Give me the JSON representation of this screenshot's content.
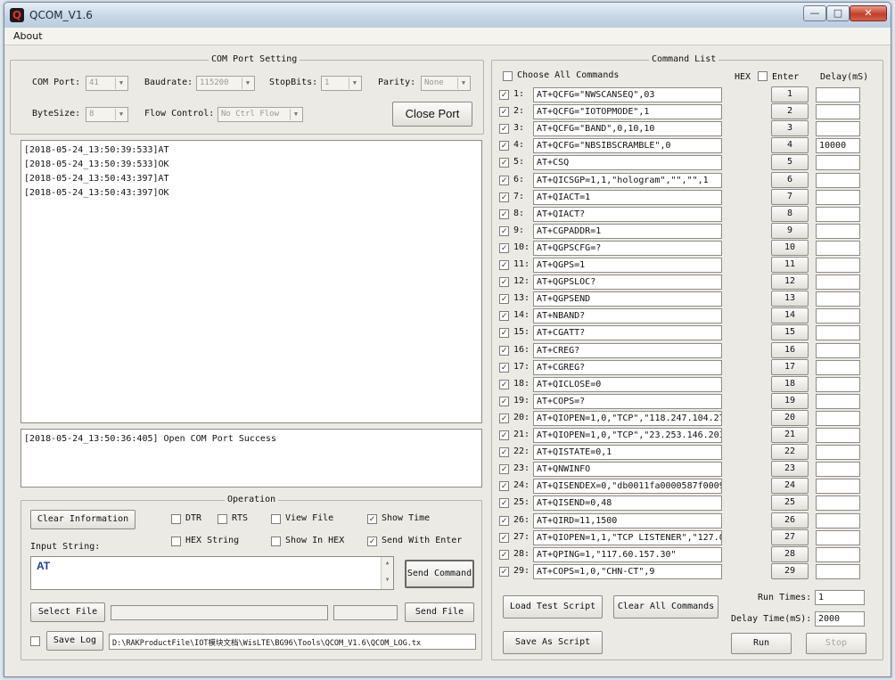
{
  "window": {
    "title": "QCOM_V1.6",
    "minimize": "—",
    "maximize": "□",
    "close": "✕"
  },
  "menu": {
    "about": "About"
  },
  "com_port_setting": {
    "title": "COM Port Setting",
    "com_port_label": "COM Port:",
    "com_port_value": "41",
    "baudrate_label": "Baudrate:",
    "baudrate_value": "115200",
    "stopbits_label": "StopBits:",
    "stopbits_value": "1",
    "parity_label": "Parity:",
    "parity_value": "None",
    "bytesize_label": "ByteSize:",
    "bytesize_value": "8",
    "flow_control_label": "Flow Control:",
    "flow_control_value": "No Ctrl Flow",
    "close_port_button": "Close Port"
  },
  "receive_log": [
    "[2018-05-24_13:50:39:533]AT",
    "[2018-05-24_13:50:39:533]OK",
    "[2018-05-24_13:50:43:397]AT",
    "[2018-05-24_13:50:43:397]OK"
  ],
  "status_log": [
    "[2018-05-24_13:50:36:405] Open COM Port Success"
  ],
  "operation": {
    "title": "Operation",
    "clear_information": "Clear Information",
    "dtr": "DTR",
    "dtr_checked": false,
    "rts": "RTS",
    "rts_checked": false,
    "view_file": "View File",
    "view_file_checked": false,
    "show_time": "Show Time",
    "show_time_checked": true,
    "hex_string": "HEX String",
    "hex_string_checked": false,
    "show_in_hex": "Show In HEX",
    "show_in_hex_checked": false,
    "send_with_enter": "Send With Enter",
    "send_with_enter_checked": true,
    "input_string_label": "Input String:",
    "input_string_value": "AT",
    "send_command": "Send Command",
    "select_file": "Select File",
    "send_file": "Send File",
    "save_log": "Save Log",
    "save_log_checked": false,
    "log_path": "D:\\RAKProductFile\\IOT模块文档\\WisLTE\\BG96\\Tools\\QCOM_V1.6\\QCOM_LOG.tx"
  },
  "command_list": {
    "title": "Command List",
    "choose_all_label": "Choose All Commands",
    "hex_header": "HEX",
    "enter_header": "Enter",
    "delay_header": "Delay(mS)",
    "commands": [
      {
        "num": "1:",
        "cmd": "AT+QCFG=\"NWSCANSEQ\",03",
        "checked": true,
        "hex": false,
        "enter": true,
        "button": "1",
        "delay": ""
      },
      {
        "num": "2:",
        "cmd": "AT+QCFG=\"IOTOPMODE\",1",
        "checked": true,
        "hex": false,
        "enter": true,
        "button": "2",
        "delay": ""
      },
      {
        "num": "3:",
        "cmd": "AT+QCFG=\"BAND\",0,10,10",
        "checked": true,
        "hex": false,
        "enter": true,
        "button": "3",
        "delay": ""
      },
      {
        "num": "4:",
        "cmd": "AT+QCFG=\"NBSIBSCRAMBLE\",0",
        "checked": true,
        "hex": false,
        "enter": true,
        "button": "4",
        "delay": "10000"
      },
      {
        "num": "5:",
        "cmd": "AT+CSQ",
        "checked": true,
        "hex": false,
        "enter": true,
        "button": "5",
        "delay": ""
      },
      {
        "num": "6:",
        "cmd": "AT+QICSGP=1,1,\"hologram\",\"\",\"\",1",
        "checked": true,
        "hex": false,
        "enter": true,
        "button": "6",
        "delay": ""
      },
      {
        "num": "7:",
        "cmd": "AT+QIACT=1",
        "checked": true,
        "hex": false,
        "enter": true,
        "button": "7",
        "delay": ""
      },
      {
        "num": "8:",
        "cmd": "AT+QIACT?",
        "checked": true,
        "hex": false,
        "enter": true,
        "button": "8",
        "delay": ""
      },
      {
        "num": "9:",
        "cmd": "AT+CGPADDR=1",
        "checked": false,
        "hex": false,
        "enter": true,
        "button": "9",
        "delay": ""
      },
      {
        "num": "10:",
        "cmd": "AT+QGPSCFG=?",
        "checked": false,
        "hex": false,
        "enter": true,
        "button": "10",
        "delay": ""
      },
      {
        "num": "11:",
        "cmd": "AT+QGPS=1",
        "checked": false,
        "hex": false,
        "enter": true,
        "button": "11",
        "delay": ""
      },
      {
        "num": "12:",
        "cmd": "AT+QGPSLOC?",
        "checked": false,
        "hex": false,
        "enter": true,
        "button": "12",
        "delay": ""
      },
      {
        "num": "13:",
        "cmd": "AT+QGPSEND",
        "checked": false,
        "hex": false,
        "enter": true,
        "button": "13",
        "delay": ""
      },
      {
        "num": "14:",
        "cmd": "AT+NBAND?",
        "checked": false,
        "hex": false,
        "enter": true,
        "button": "14",
        "delay": ""
      },
      {
        "num": "15:",
        "cmd": "AT+CGATT?",
        "checked": false,
        "hex": false,
        "enter": true,
        "button": "15",
        "delay": ""
      },
      {
        "num": "16:",
        "cmd": "AT+CREG?",
        "checked": false,
        "hex": false,
        "enter": true,
        "button": "16",
        "delay": ""
      },
      {
        "num": "17:",
        "cmd": "AT+CGREG?",
        "checked": false,
        "hex": false,
        "enter": true,
        "button": "17",
        "delay": ""
      },
      {
        "num": "18:",
        "cmd": "AT+QICLOSE=0",
        "checked": false,
        "hex": false,
        "enter": true,
        "button": "18",
        "delay": ""
      },
      {
        "num": "19:",
        "cmd": "AT+COPS=?",
        "checked": false,
        "hex": false,
        "enter": true,
        "button": "19",
        "delay": ""
      },
      {
        "num": "20:",
        "cmd": "AT+QIOPEN=1,0,\"TCP\",\"118.247.104.27",
        "checked": false,
        "hex": false,
        "enter": true,
        "button": "20",
        "delay": ""
      },
      {
        "num": "21:",
        "cmd": "AT+QIOPEN=1,0,\"TCP\",\"23.253.146.203",
        "checked": false,
        "hex": false,
        "enter": true,
        "button": "21",
        "delay": ""
      },
      {
        "num": "22:",
        "cmd": "AT+QISTATE=0,1",
        "checked": false,
        "hex": false,
        "enter": true,
        "button": "22",
        "delay": ""
      },
      {
        "num": "23:",
        "cmd": "AT+QNWINFO",
        "checked": false,
        "hex": false,
        "enter": true,
        "button": "23",
        "delay": ""
      },
      {
        "num": "24:",
        "cmd": "AT+QISENDEX=0,\"db0011fa0000587f0009",
        "checked": false,
        "hex": false,
        "enter": true,
        "button": "24",
        "delay": ""
      },
      {
        "num": "25:",
        "cmd": "AT+QISEND=0,48",
        "checked": false,
        "hex": false,
        "enter": true,
        "button": "25",
        "delay": ""
      },
      {
        "num": "26:",
        "cmd": "AT+QIRD=11,1500",
        "checked": false,
        "hex": false,
        "enter": true,
        "button": "26",
        "delay": ""
      },
      {
        "num": "27:",
        "cmd": "AT+QIOPEN=1,1,\"TCP LISTENER\",\"127.0.",
        "checked": false,
        "hex": false,
        "enter": true,
        "button": "27",
        "delay": ""
      },
      {
        "num": "28:",
        "cmd": "AT+QPING=1,\"117.60.157.30\"",
        "checked": false,
        "hex": false,
        "enter": true,
        "button": "28",
        "delay": ""
      },
      {
        "num": "29:",
        "cmd": "AT+COPS=1,0,\"CHN-CT\",9",
        "checked": false,
        "hex": false,
        "enter": true,
        "button": "29",
        "delay": ""
      }
    ],
    "load_test_script": "Load Test Script",
    "clear_all_commands": "Clear All Commands",
    "save_as_script": "Save As Script",
    "run_times_label": "Run Times:",
    "run_times_value": "1",
    "delay_time_label": "Delay Time(mS):",
    "delay_time_value": "2000",
    "run": "Run",
    "stop": "Stop"
  }
}
